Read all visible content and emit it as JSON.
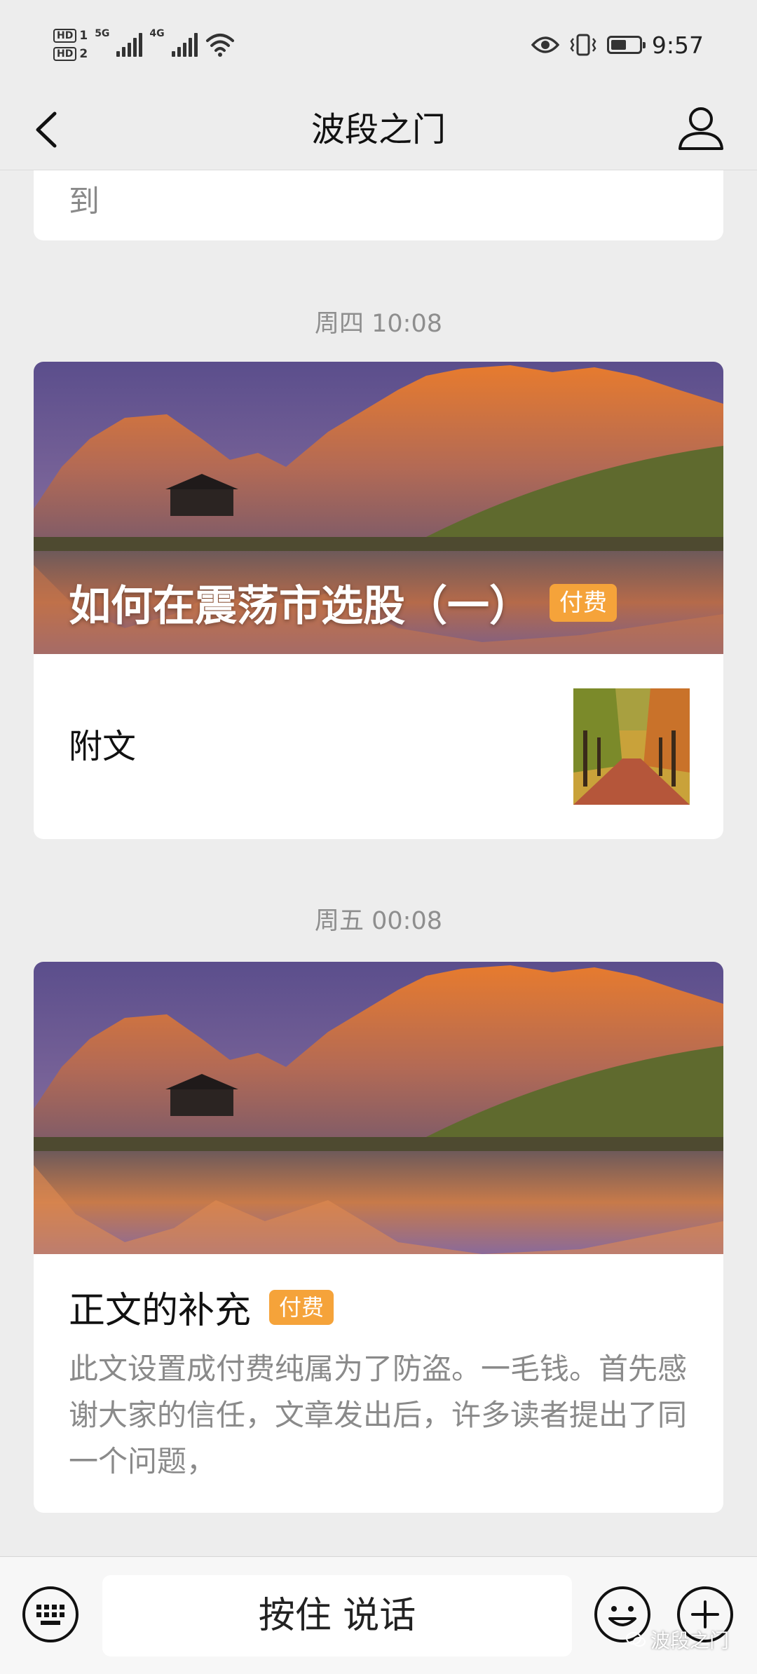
{
  "status_bar": {
    "hd1": "HD",
    "hd1_sub": "1",
    "hd2": "HD",
    "hd2_sub": "2",
    "net1": "5G",
    "net2": "4G",
    "time": "9:57",
    "battery_level_pct": 55
  },
  "nav": {
    "title": "波段之门"
  },
  "feed": {
    "prev_snippet": "到",
    "messages": [
      {
        "timestamp": "周四 10:08",
        "cover_title": "如何在震荡市选股（一）",
        "badge": "付费",
        "sub_title": "附文"
      },
      {
        "timestamp": "周五 00:08",
        "article_title": "正文的补充",
        "badge": "付费",
        "article_desc": "此文设置成付费纯属为了防盗。一毛钱。首先感谢大家的信任，文章发出后，许多读者提出了同一个问题，"
      }
    ]
  },
  "input_bar": {
    "hold_to_talk": "按住 说话",
    "watermark": "波段之门"
  },
  "colors": {
    "background": "#ededed",
    "badge": "#f5a33a",
    "timestamp": "#8e8e8e",
    "muted_text": "#8a8a8a"
  }
}
